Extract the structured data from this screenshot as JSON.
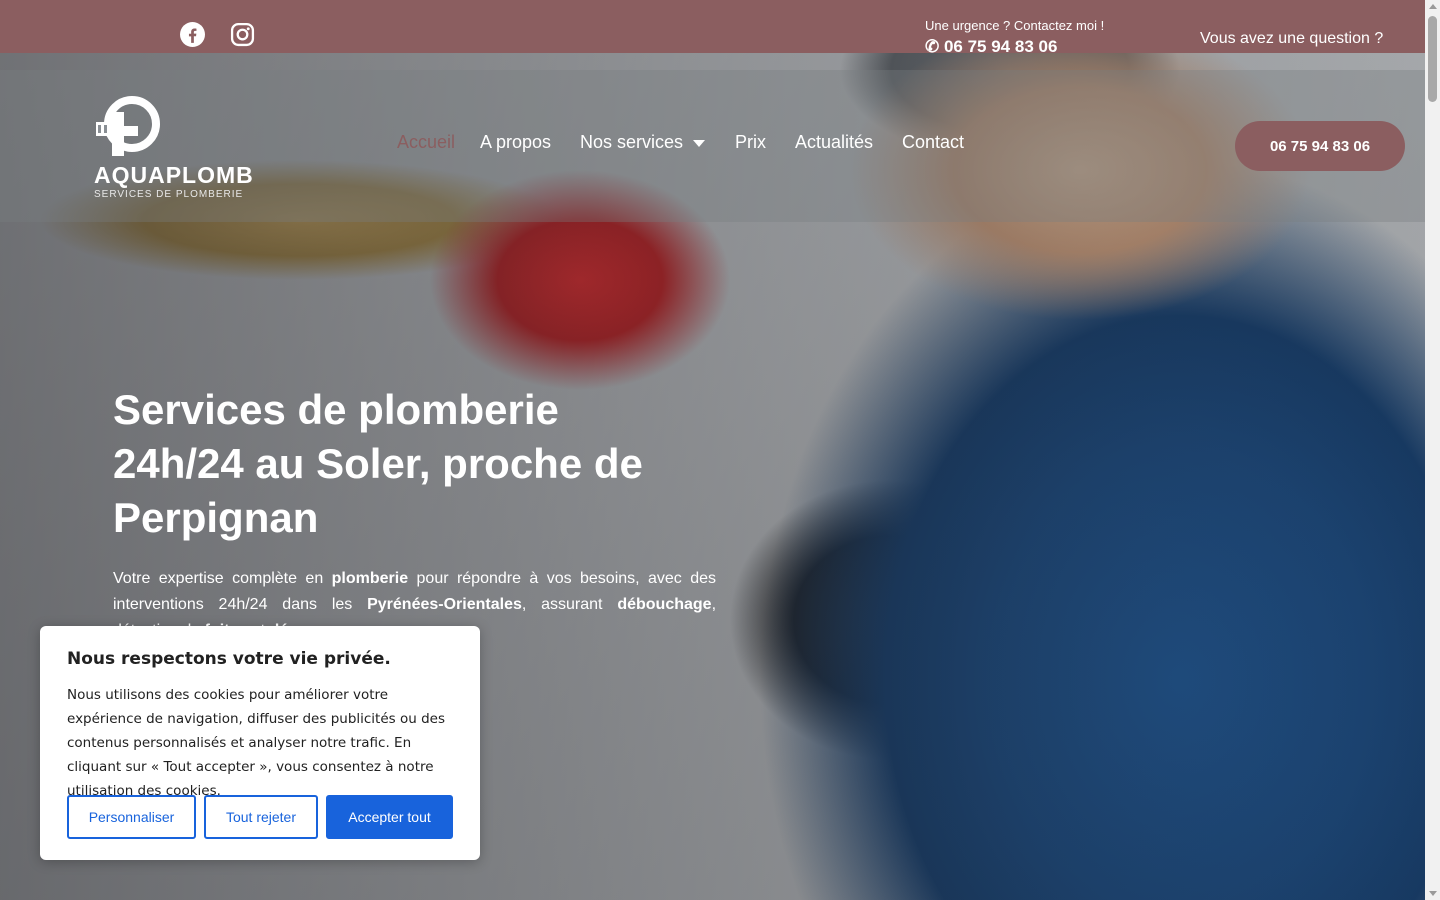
{
  "topbar": {
    "urgent_label": "Une urgence ? Contactez moi !",
    "urgent_phone": "✆ 06 75 94 83 06",
    "question_link": "Vous avez une question ?",
    "social": [
      "facebook-icon",
      "instagram-icon"
    ],
    "bg_color": "#8b5e60"
  },
  "logo": {
    "name": "AQUAPLOMB",
    "tagline": "SERVICES DE PLOMBERIE"
  },
  "nav": {
    "items": [
      {
        "label": "Accueil",
        "active": true
      },
      {
        "label": "A propos"
      },
      {
        "label": "Nos services",
        "has_dropdown": true
      },
      {
        "label": "Prix"
      },
      {
        "label": "Actualités"
      },
      {
        "label": "Contact"
      }
    ],
    "phone_button": "06 75 94 83 06"
  },
  "hero": {
    "title_line1": "Services de plomberie",
    "title_line2": "24h/24 au Soler, proche de",
    "title_line3": "Perpignan",
    "text_1": "Votre expertise complète en ",
    "text_b1": "plomberie",
    "text_2": " pour répondre à vos besoins, avec des interventions 24h/24 dans les ",
    "text_b2": "Pyrénées-Orientales",
    "text_3": ", assurant ",
    "text_b3": "débouchage",
    "text_4": ", détection de ",
    "text_b4": "fuites",
    "text_5": " et ",
    "text_b5": "dépannage",
    "text_6": "."
  },
  "cookie": {
    "title": "Nous respectons votre vie privée.",
    "text": "Nous utilisons des cookies pour améliorer votre expérience de navigation, diffuser des publicités ou des contenus personnalisés et analyser notre trafic. En cliquant sur « Tout accepter », vous consentez à notre utilisation des cookies.",
    "customize": "Personnaliser",
    "reject": "Tout rejeter",
    "accept": "Accepter tout",
    "accent_color": "#1863dc"
  }
}
